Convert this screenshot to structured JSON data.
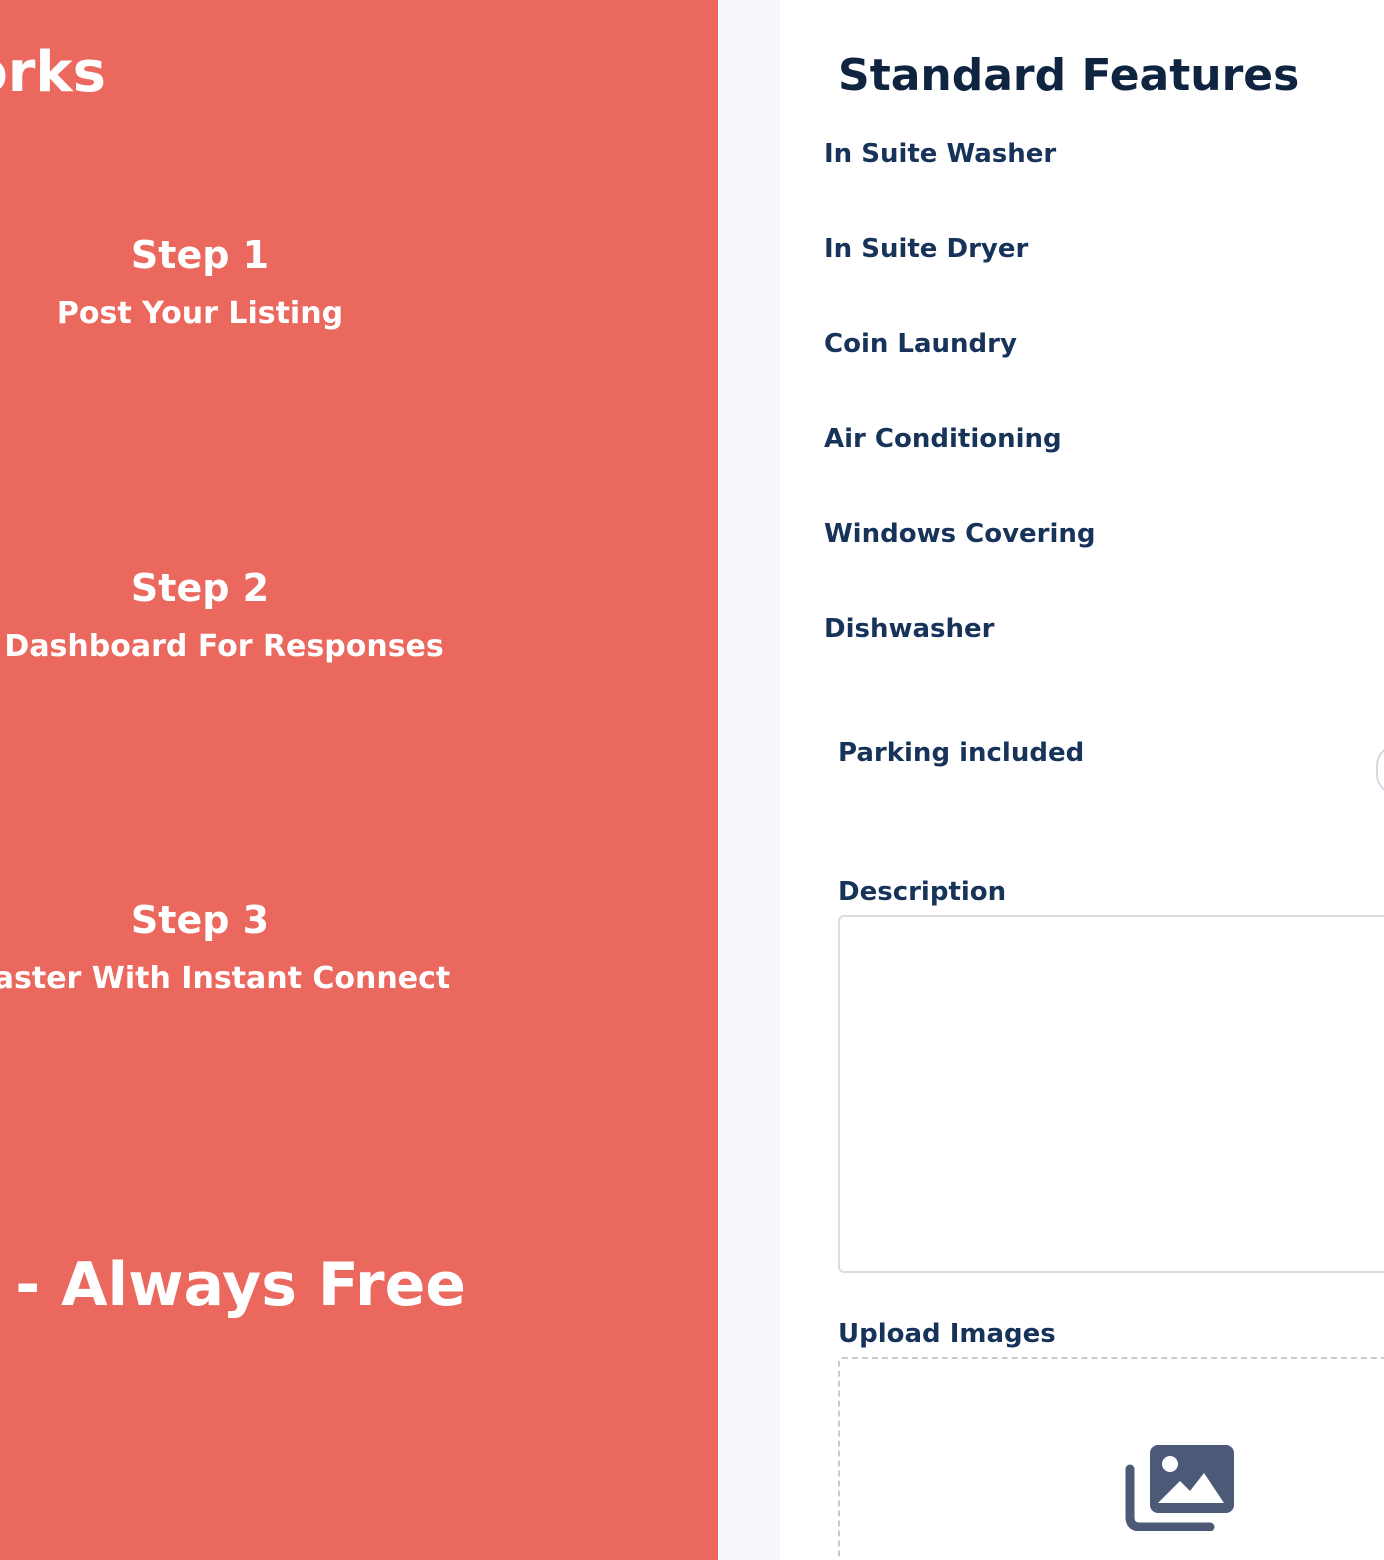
{
  "promo": {
    "header": "orks",
    "steps": [
      {
        "title": "Step 1",
        "subtitle": "Post Your Listing"
      },
      {
        "title": "Step 2",
        "subtitle": "ck Dashboard For Responses"
      },
      {
        "title": "Step 3",
        "subtitle": "r Faster With Instant Connect"
      }
    ],
    "footer": "ngs - Always Free"
  },
  "form": {
    "section_title": "Standard Features",
    "features": [
      "In Suite Washer",
      "In Suite Dryer",
      "Coin Laundry",
      "Air Conditioning",
      "Windows Covering",
      "Dishwasher"
    ],
    "parking_label": "Parking included",
    "description_label": "Description",
    "description_value": "",
    "upload_label": "Upload Images",
    "upload_icon": "images-icon"
  },
  "colors": {
    "promo_bg": "#EA685D",
    "text_dark": "#0F2440",
    "label": "#17335A",
    "icon": "#4C5A78"
  }
}
